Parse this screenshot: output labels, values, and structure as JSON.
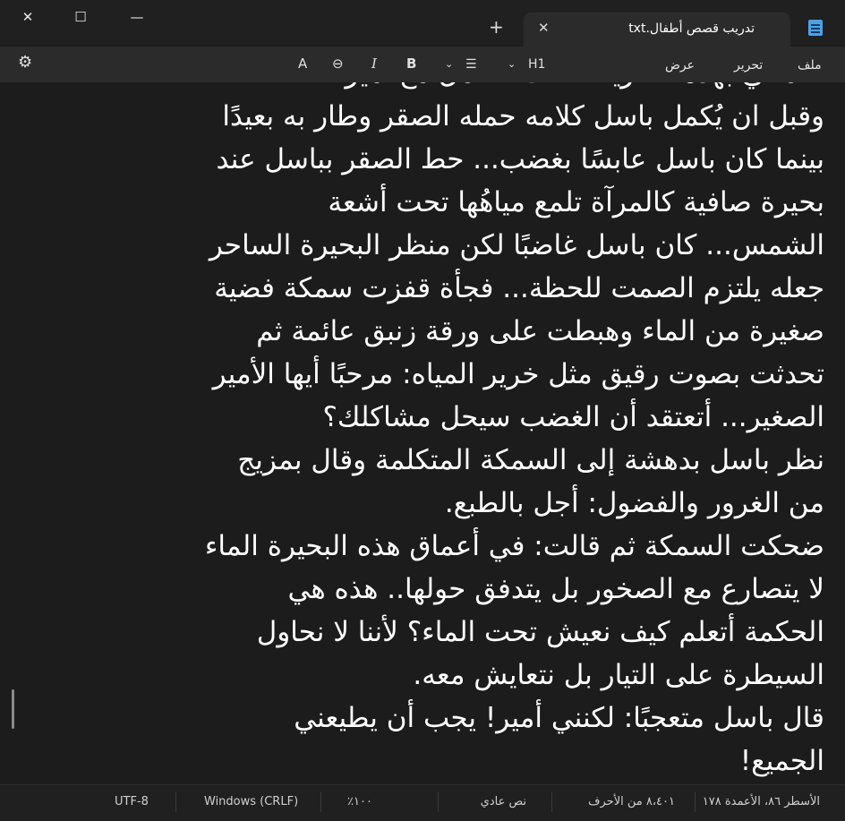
{
  "window": {
    "tab_title": "تدريب قصص أطفال.txt",
    "close_glyph": "✕",
    "maximize_glyph": "☐",
    "minimize_glyph": "—",
    "tab_close_glyph": "✕",
    "new_tab_glyph": "+"
  },
  "menu": {
    "file": "ملف",
    "edit": "تحرير",
    "view": "عرض"
  },
  "toolbar": {
    "heading": "H1",
    "list_glyph": "☰",
    "chevron": "⌄",
    "bold": "B",
    "italic": "I",
    "link_glyph": "⊖",
    "clear_format": "A",
    "settings_glyph": "⚙"
  },
  "editor": {
    "lines": [
      "تحمّلني بهذه الطريقة! أنت تتعامل مع أمير...",
      "وقبل ان يُكمل باسل كلامه حمله الصقر وطار به بعيدًا",
      "بينما كان باسل عابسًا بغضب... حط الصقر بباسل عند",
      "بحيرة صافية كالمرآة تلمع مياهُها تحت أشعة",
      "الشمس... كان باسل غاضبًا لكن منظر البحيرة الساحر",
      "جعله يلتزم الصمت للحظة... فجأة قفزت سمكة فضية",
      "صغيرة من الماء وهبطت على ورقة زنبق عائمة ثم",
      "تحدثت بصوت رقيق مثل خرير المياه: مرحبًا أيها الأمير",
      "الصغير... أتعتقد أن الغضب سيحل مشاكلك؟",
      "نظر باسل بدهشة إلى السمكة المتكلمة وقال بمزيج",
      "من الغرور والفضول: أجل بالطبع.",
      "ضحكت السمكة ثم قالت: في أعماق هذه البحيرة الماء",
      " لا يتصارع مع الصخور بل يتدفق حولها.. هذه هي",
      "الحكمة أتعلم كيف نعيش تحت الماء؟ لأننا لا نحاول",
      "السيطرة على التيار بل نتعايش معه.",
      "قال باسل متعجبًا: لكنني أمير! يجب أن يطيعني",
      "الجميع!"
    ]
  },
  "status": {
    "position": "الأسطر ٨٦، الأعمدة ١٧٨",
    "chars": "٨،٤٠١ من الأحرف",
    "format": "نص عادي",
    "zoom": "١٠٠٪",
    "line_ending": "Windows (CRLF)",
    "encoding": "UTF-8"
  }
}
